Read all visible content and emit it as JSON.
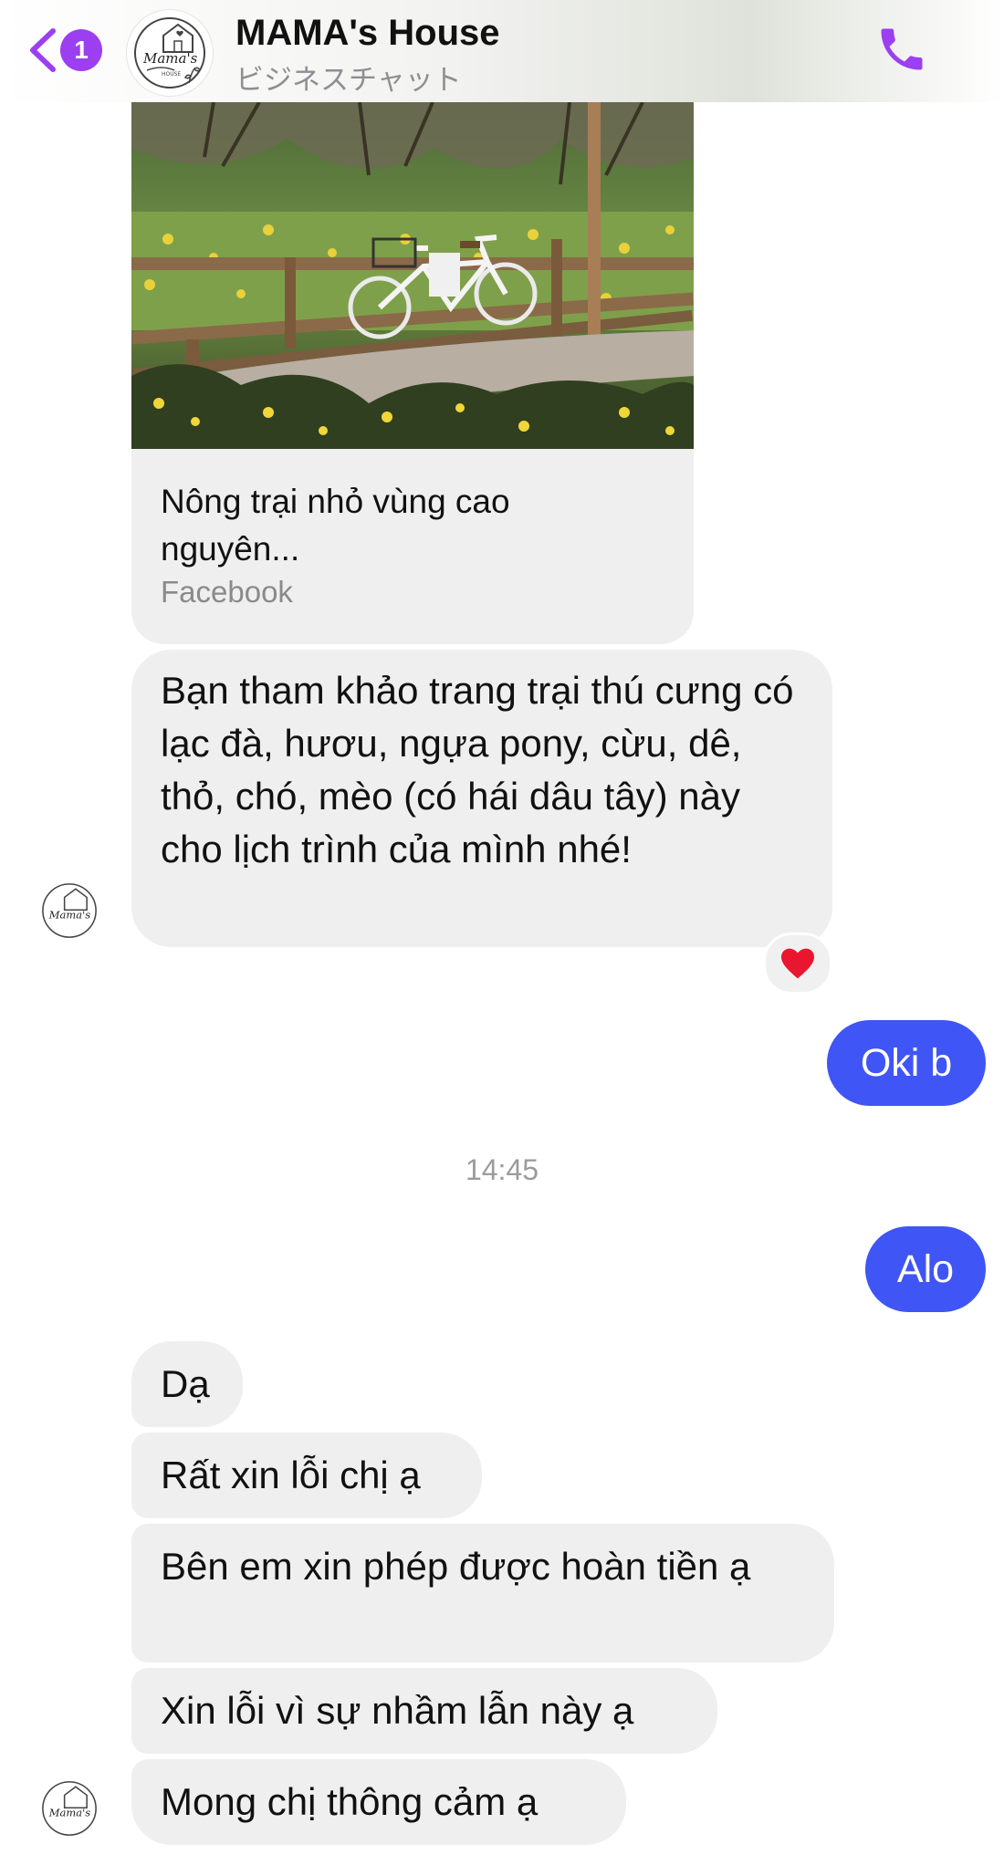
{
  "header": {
    "unread_badge": "1",
    "title": "MAMA's House",
    "subtitle": "ビジネスチャット",
    "avatar_logo_text": "Mama's",
    "avatar_logo_sub": "HOUSE"
  },
  "colors": {
    "accent_purple": "#9b3ff0",
    "outgoing_bubble": "#3f55f5",
    "incoming_bubble": "#efefef"
  },
  "icons": {
    "back": "chevron-left-icon",
    "call": "phone-icon",
    "reaction": "heart-icon"
  },
  "link_card": {
    "title": "Nông trại nhỏ vùng cao nguyên...",
    "source": "Facebook"
  },
  "messages": {
    "m1": "Bạn tham khảo trang trại thú cưng có lạc đà, hươu, ngựa pony, cừu, dê, thỏ, chó, mèo (có hái dâu tây) này cho lịch trình của mình nhé!",
    "m2": "Oki b",
    "timestamp": "14:45",
    "m3": "Alo",
    "m4": "Dạ",
    "m5": "Rất xin lỗi chị ạ",
    "m6": "Bên em xin phép được hoàn tiền ạ",
    "m7": "Xin lỗi vì sự nhầm lẫn này ạ",
    "m8": "Mong chị thông cảm ạ"
  }
}
